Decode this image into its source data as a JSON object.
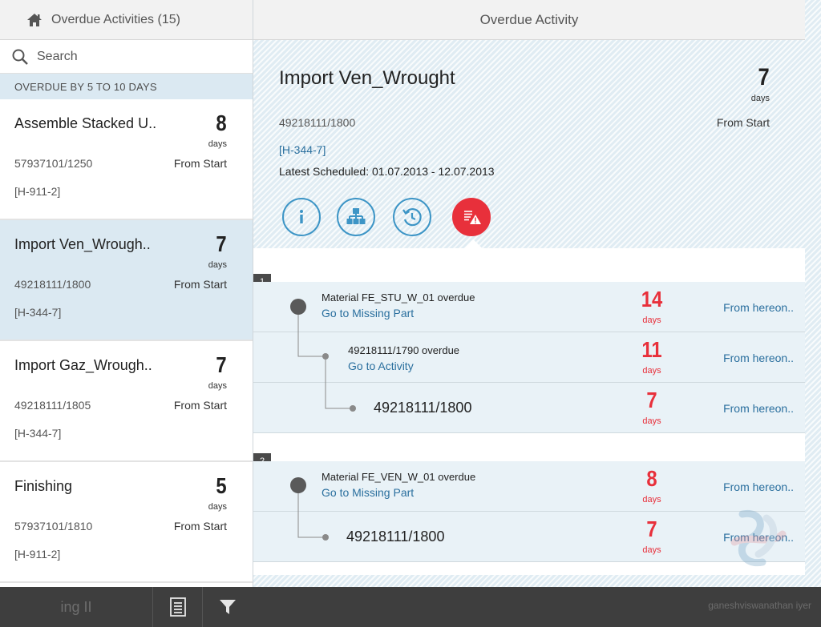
{
  "left_header": {
    "title": "Overdue Activities (15)",
    "icon": "home-icon"
  },
  "search": {
    "placeholder": "Search",
    "icon": "search-icon"
  },
  "group_header": "OVERDUE BY 5 TO 10 DAYS",
  "list": [
    {
      "name": "Assemble Stacked U..",
      "days": "8",
      "unit": "days",
      "code": "57937101/1250",
      "from": "From Start",
      "tag": "[H-911-2]",
      "selected": false
    },
    {
      "name": "Import Ven_Wrough..",
      "days": "7",
      "unit": "days",
      "code": "49218111/1800",
      "from": "From Start",
      "tag": "[H-344-7]",
      "selected": true
    },
    {
      "name": "Import Gaz_Wrough..",
      "days": "7",
      "unit": "days",
      "code": "49218111/1805",
      "from": "From Start",
      "tag": "[H-344-7]",
      "selected": false
    },
    {
      "name": "Finishing",
      "days": "5",
      "unit": "days",
      "code": "57937101/1810",
      "from": "From Start",
      "tag": "[H-911-2]",
      "selected": false
    }
  ],
  "detail": {
    "header": "Overdue Activity",
    "title": "Import Ven_Wrought",
    "days": "7",
    "unit": "days",
    "code": "49218111/1800",
    "from": "From Start",
    "tag": "[H-344-7]",
    "scheduled": "Latest Scheduled: 01.07.2013 - 12.07.2013",
    "buttons": [
      "info-icon",
      "hierarchy-icon",
      "history-icon",
      "warning-list-icon"
    ],
    "groups": [
      {
        "number": "1",
        "rows": [
          {
            "title": "Material FE_STU_W_01 overdue",
            "action": "Go to Missing Part",
            "days": "14",
            "unit": "days",
            "link": "From hereon.."
          },
          {
            "title": "49218111/1790 overdue",
            "action": "Go to Activity",
            "days": "11",
            "unit": "days",
            "link": "From hereon.."
          },
          {
            "title": "49218111/1800",
            "days": "7",
            "unit": "days",
            "link": "From hereon.."
          }
        ]
      },
      {
        "number": "2",
        "rows": [
          {
            "title": "Material FE_VEN_W_01 overdue",
            "action": "Go to Missing Part",
            "days": "8",
            "unit": "days",
            "link": "From hereon.."
          },
          {
            "title": "49218111/1800",
            "days": "7",
            "unit": "days",
            "link": "From hereon.."
          }
        ]
      }
    ]
  },
  "bottombar": {
    "left_text": "ing II",
    "credit": "ganeshviswanathan iyer",
    "buttons": [
      "list-icon",
      "filter-icon"
    ]
  },
  "colors": {
    "accent": "#2a6f9e",
    "alert": "#e8303b",
    "selected_bg": "#dbe9f2"
  }
}
